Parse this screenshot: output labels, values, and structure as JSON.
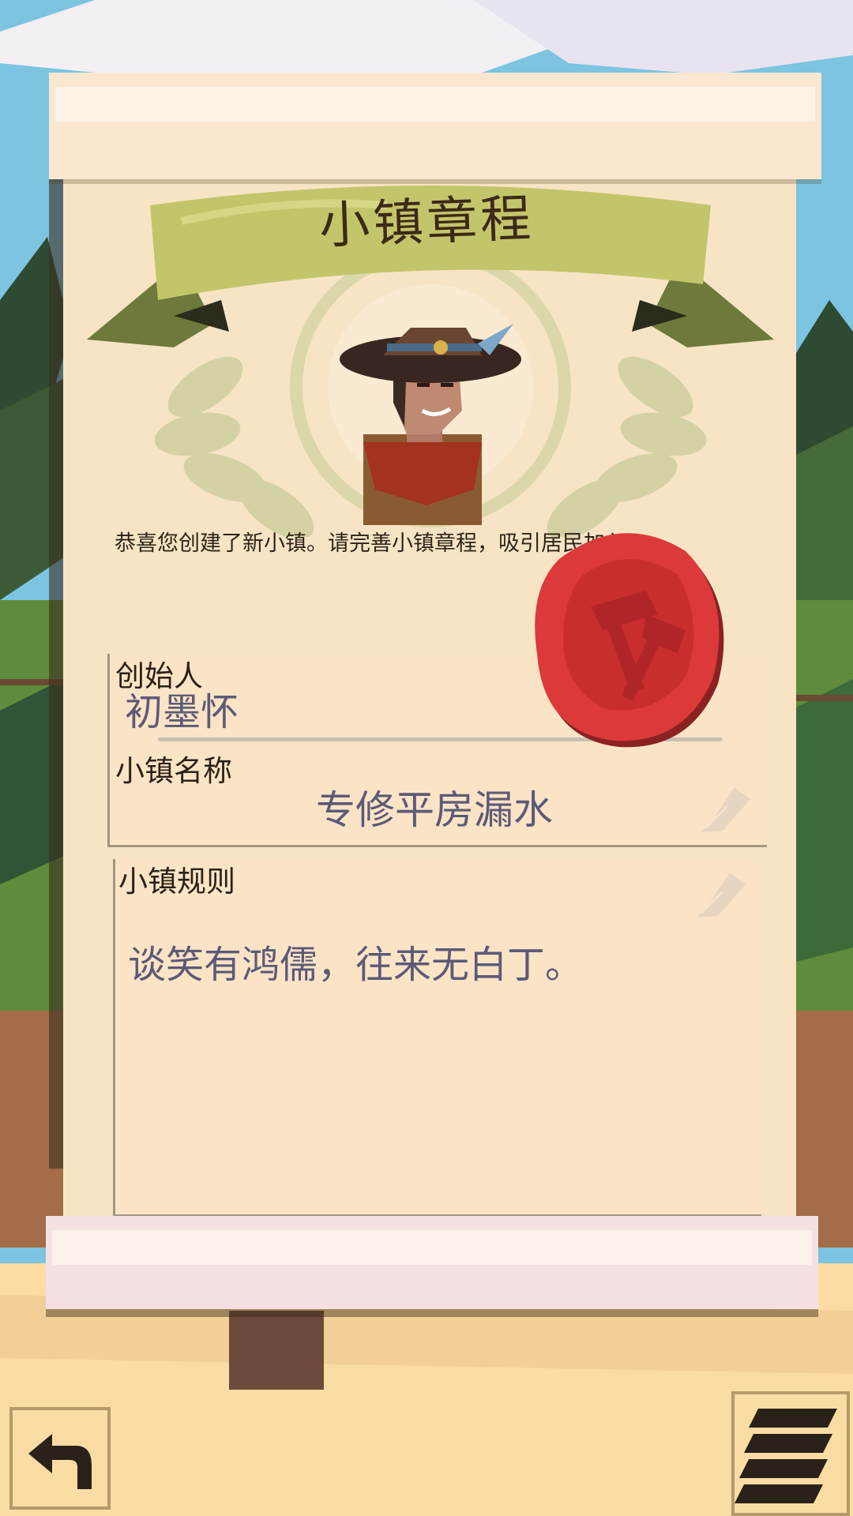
{
  "charter": {
    "title": "小镇章程",
    "intro": "恭喜您创建了新小镇。请完善小镇章程，吸引居民加入。",
    "founder_label": "创始人",
    "founder_name": "初墨怀",
    "town_name_label": "小镇名称",
    "town_name": "专修平房漏水",
    "rules_label": "小镇规则",
    "rules_text": "谈笑有鸿儒，往来无白丁。"
  },
  "icons": {
    "seal": "wax-seal-hammer-icon",
    "edit": "pen-nib-icon",
    "back": "undo-arrow-icon",
    "menu": "stacked-pages-icon"
  },
  "colors": {
    "paper": "#f7e4c5",
    "ribbon": "#c3c56a",
    "seal": "#d93a3a",
    "value_text": "#5d5a78"
  }
}
